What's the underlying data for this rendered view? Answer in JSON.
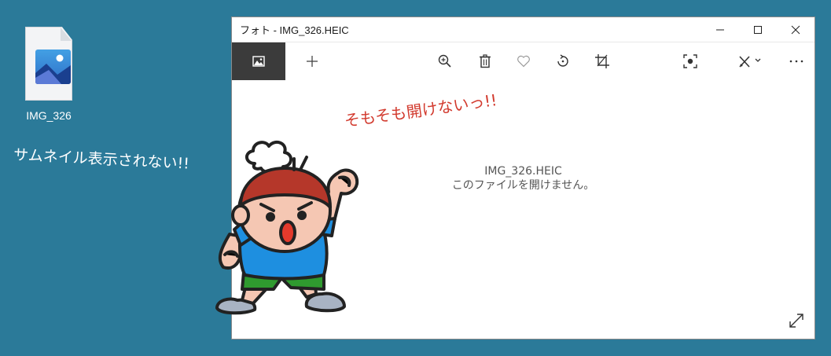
{
  "desktop": {
    "file_label": "IMG_326",
    "caption": "サムネイル表示されない!!"
  },
  "window": {
    "title": "フォト - IMG_326.HEIC",
    "controls": {
      "minimize": "minimize-icon",
      "maximize": "maximize-icon",
      "close": "close-icon"
    }
  },
  "toolbar": {
    "icons": [
      "image-view-icon",
      "add-icon",
      "zoom-icon",
      "delete-icon",
      "favorite-icon",
      "rotate-icon",
      "crop-icon",
      "enhance-icon",
      "edit-draw-icon",
      "more-icon"
    ]
  },
  "viewer": {
    "filename": "IMG_326.HEIC",
    "error": "このファイルを開けません。"
  },
  "overlay": {
    "exclaim": "そもそも開けないっ!!"
  },
  "colors": {
    "desktop_bg": "#2b7a99",
    "active_tool_bg": "#3b3b3b",
    "exclaim": "#d23a2e"
  }
}
